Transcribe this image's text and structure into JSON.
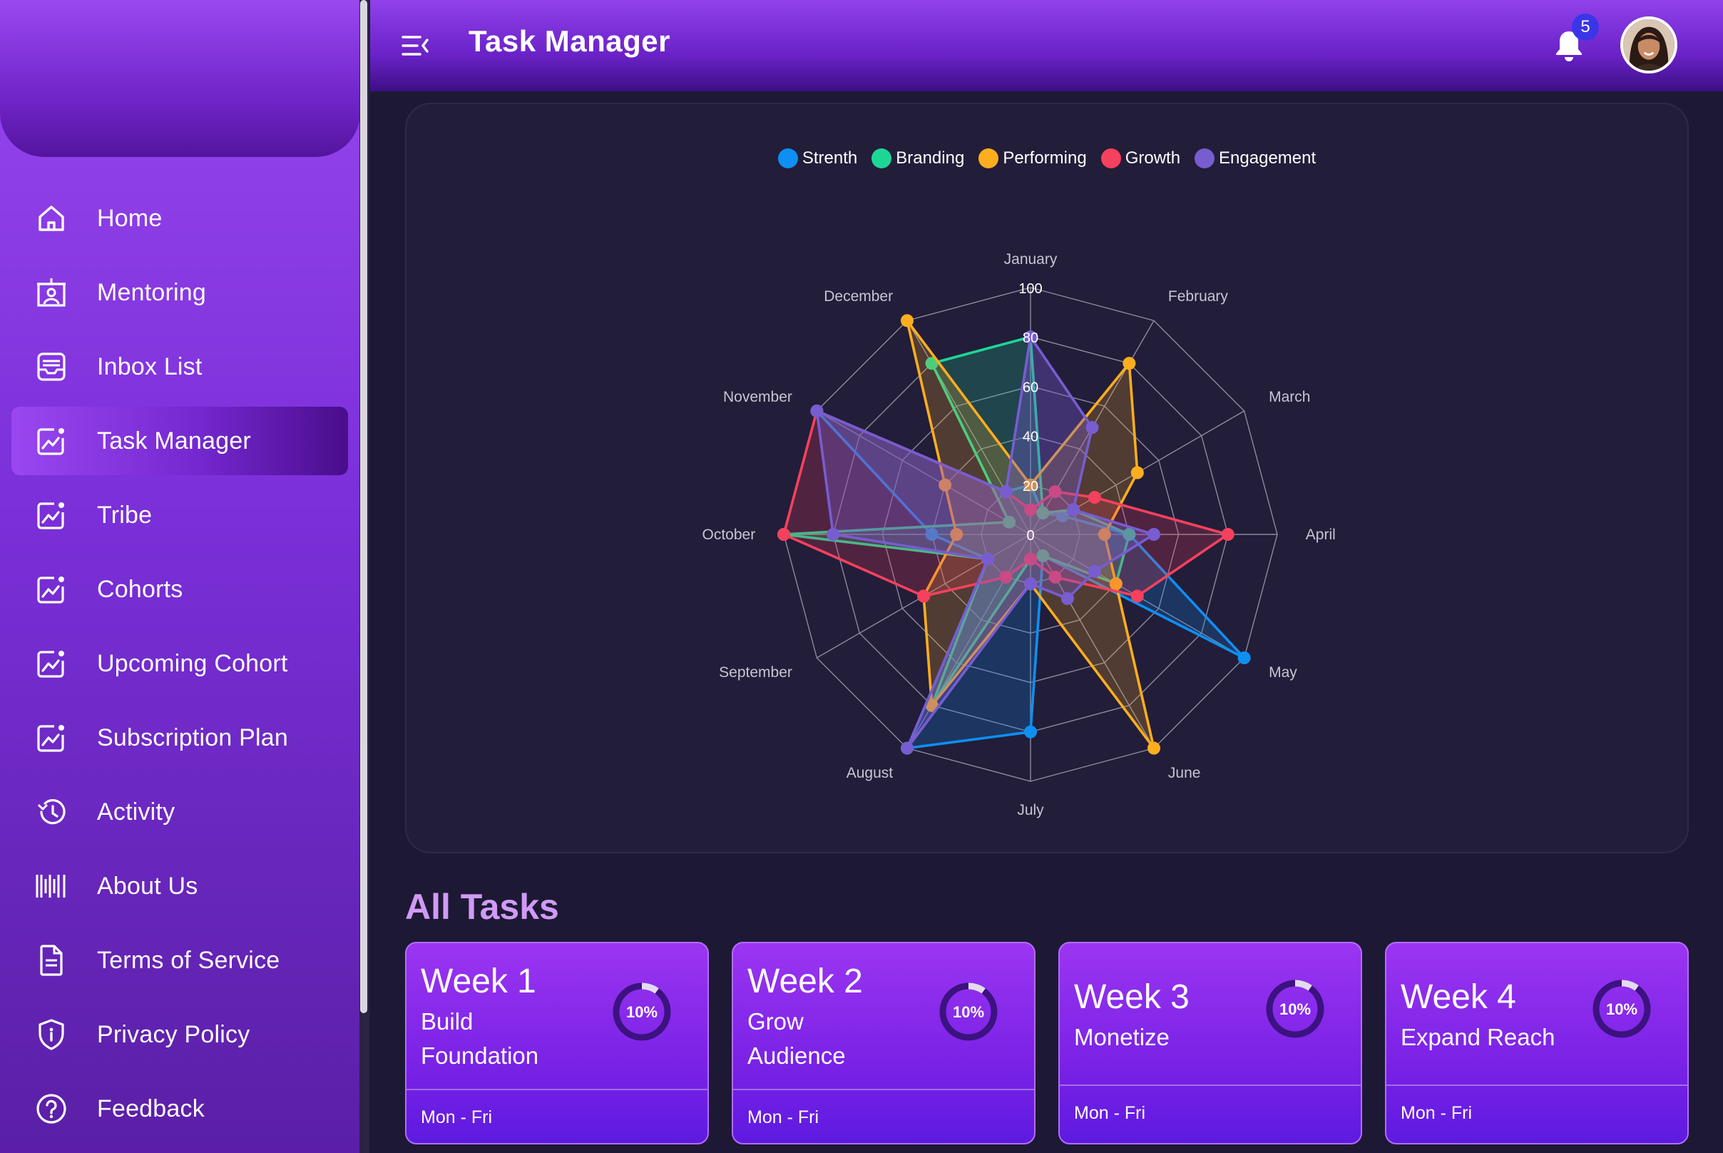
{
  "header": {
    "title": "Task Manager",
    "notifications_count": "5",
    "icons": {
      "menu": "menu-collapse-icon",
      "notifications": "bell-icon",
      "avatar": "user-avatar"
    }
  },
  "sidebar": {
    "items": [
      {
        "label": "Home",
        "icon": "home-icon",
        "active": false
      },
      {
        "label": "Mentoring",
        "icon": "mentoring-icon",
        "active": false
      },
      {
        "label": "Inbox List",
        "icon": "inbox-icon",
        "active": false
      },
      {
        "label": "Task Manager",
        "icon": "chart-board-icon",
        "active": true
      },
      {
        "label": "Tribe",
        "icon": "chart-board-icon",
        "active": false
      },
      {
        "label": "Cohorts",
        "icon": "chart-board-icon",
        "active": false
      },
      {
        "label": "Upcoming Cohort",
        "icon": "chart-board-icon",
        "active": false
      },
      {
        "label": "Subscription Plan",
        "icon": "chart-board-icon",
        "active": false
      },
      {
        "label": "Activity",
        "icon": "history-icon",
        "active": false
      },
      {
        "label": "About Us",
        "icon": "barcode-icon",
        "active": false
      },
      {
        "label": "Terms of Service",
        "icon": "document-icon",
        "active": false
      },
      {
        "label": "Privacy Policy",
        "icon": "shield-icon",
        "active": false
      },
      {
        "label": "Feedback",
        "icon": "help-circle-icon",
        "active": false
      }
    ]
  },
  "chart_data": {
    "type": "radar",
    "title": "",
    "categories": [
      "January",
      "February",
      "March",
      "April",
      "May",
      "June",
      "July",
      "August",
      "September",
      "October",
      "November",
      "December"
    ],
    "range": [
      0,
      100
    ],
    "ticks": [
      "0",
      "20",
      "40",
      "60",
      "80",
      "100"
    ],
    "grid": true,
    "legend_position": "top-center",
    "series": [
      {
        "name": "Strenth",
        "color": "#0e8ff2",
        "fill": "rgba(14,143,242,0.22)",
        "values": [
          20,
          10,
          15,
          40,
          100,
          10,
          80,
          100,
          20,
          40,
          100,
          20
        ]
      },
      {
        "name": "Branding",
        "color": "#1dd696",
        "fill": "rgba(29,214,150,0.22)",
        "values": [
          80,
          10,
          20,
          40,
          40,
          10,
          10,
          80,
          20,
          100,
          10,
          80
        ]
      },
      {
        "name": "Performing",
        "color": "#fcae1e",
        "fill": "rgba(252,174,30,0.22)",
        "values": [
          20,
          80,
          50,
          30,
          40,
          100,
          20,
          80,
          50,
          30,
          40,
          100
        ]
      },
      {
        "name": "Growth",
        "color": "#f5415d",
        "fill": "rgba(245,65,93,0.22)",
        "values": [
          10,
          20,
          30,
          80,
          50,
          20,
          10,
          20,
          50,
          100,
          100,
          20
        ]
      },
      {
        "name": "Engagement",
        "color": "#775dd0",
        "fill": "rgba(119,93,208,0.35)",
        "values": [
          80,
          50,
          20,
          50,
          30,
          30,
          20,
          100,
          20,
          80,
          100,
          20
        ]
      }
    ]
  },
  "tasks_section": {
    "title": "All Tasks",
    "cards": [
      {
        "week": "Week 1",
        "lines": [
          "Build",
          "Foundation"
        ],
        "progress_label": "10%",
        "progress": 10,
        "days": "Mon - Fri"
      },
      {
        "week": "Week 2",
        "lines": [
          "Grow",
          "Audience"
        ],
        "progress_label": "10%",
        "progress": 10,
        "days": "Mon - Fri"
      },
      {
        "week": "Week 3",
        "lines": [
          "Monetize"
        ],
        "progress_label": "10%",
        "progress": 10,
        "days": "Mon - Fri"
      },
      {
        "week": "Week 4",
        "lines": [
          "Expand Reach"
        ],
        "progress_label": "10%",
        "progress": 10,
        "days": "Mon - Fri"
      }
    ]
  }
}
